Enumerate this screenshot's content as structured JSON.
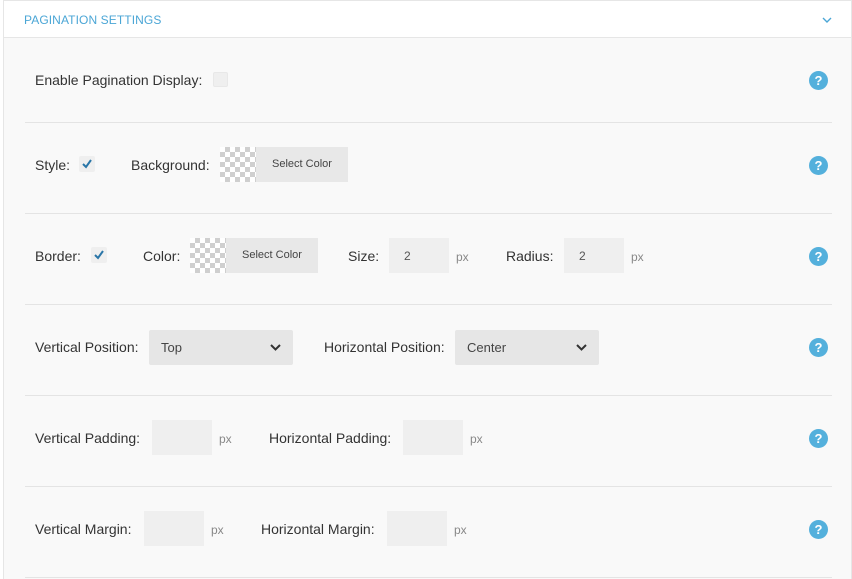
{
  "header": {
    "title": "PAGINATION SETTINGS",
    "toggle_icon": "chevron-down-icon"
  },
  "rows": {
    "enable": {
      "label": "Enable Pagination Display:",
      "checked": false
    },
    "style": {
      "label": "Style:",
      "checked": true,
      "background_label": "Background:",
      "background_button": "Select Color"
    },
    "border": {
      "label": "Border:",
      "checked": true,
      "color_label": "Color:",
      "color_button": "Select Color",
      "size_label": "Size:",
      "size_value": "2",
      "size_unit": "px",
      "radius_label": "Radius:",
      "radius_value": "2",
      "radius_unit": "px"
    },
    "position": {
      "vertical_label": "Vertical Position:",
      "vertical_value": "Top",
      "horizontal_label": "Horizontal Position:",
      "horizontal_value": "Center"
    },
    "padding": {
      "vertical_label": "Vertical Padding:",
      "vertical_value": "",
      "vertical_unit": "px",
      "horizontal_label": "Horizontal Padding:",
      "horizontal_value": "",
      "horizontal_unit": "px"
    },
    "margin": {
      "vertical_label": "Vertical Margin:",
      "vertical_value": "",
      "vertical_unit": "px",
      "horizontal_label": "Horizontal Margin:",
      "horizontal_value": "",
      "horizontal_unit": "px"
    }
  },
  "help_glyph": "?",
  "colors": {
    "accent": "#4ba6d6",
    "help": "#54b0dc",
    "check": "#2a76a8"
  }
}
